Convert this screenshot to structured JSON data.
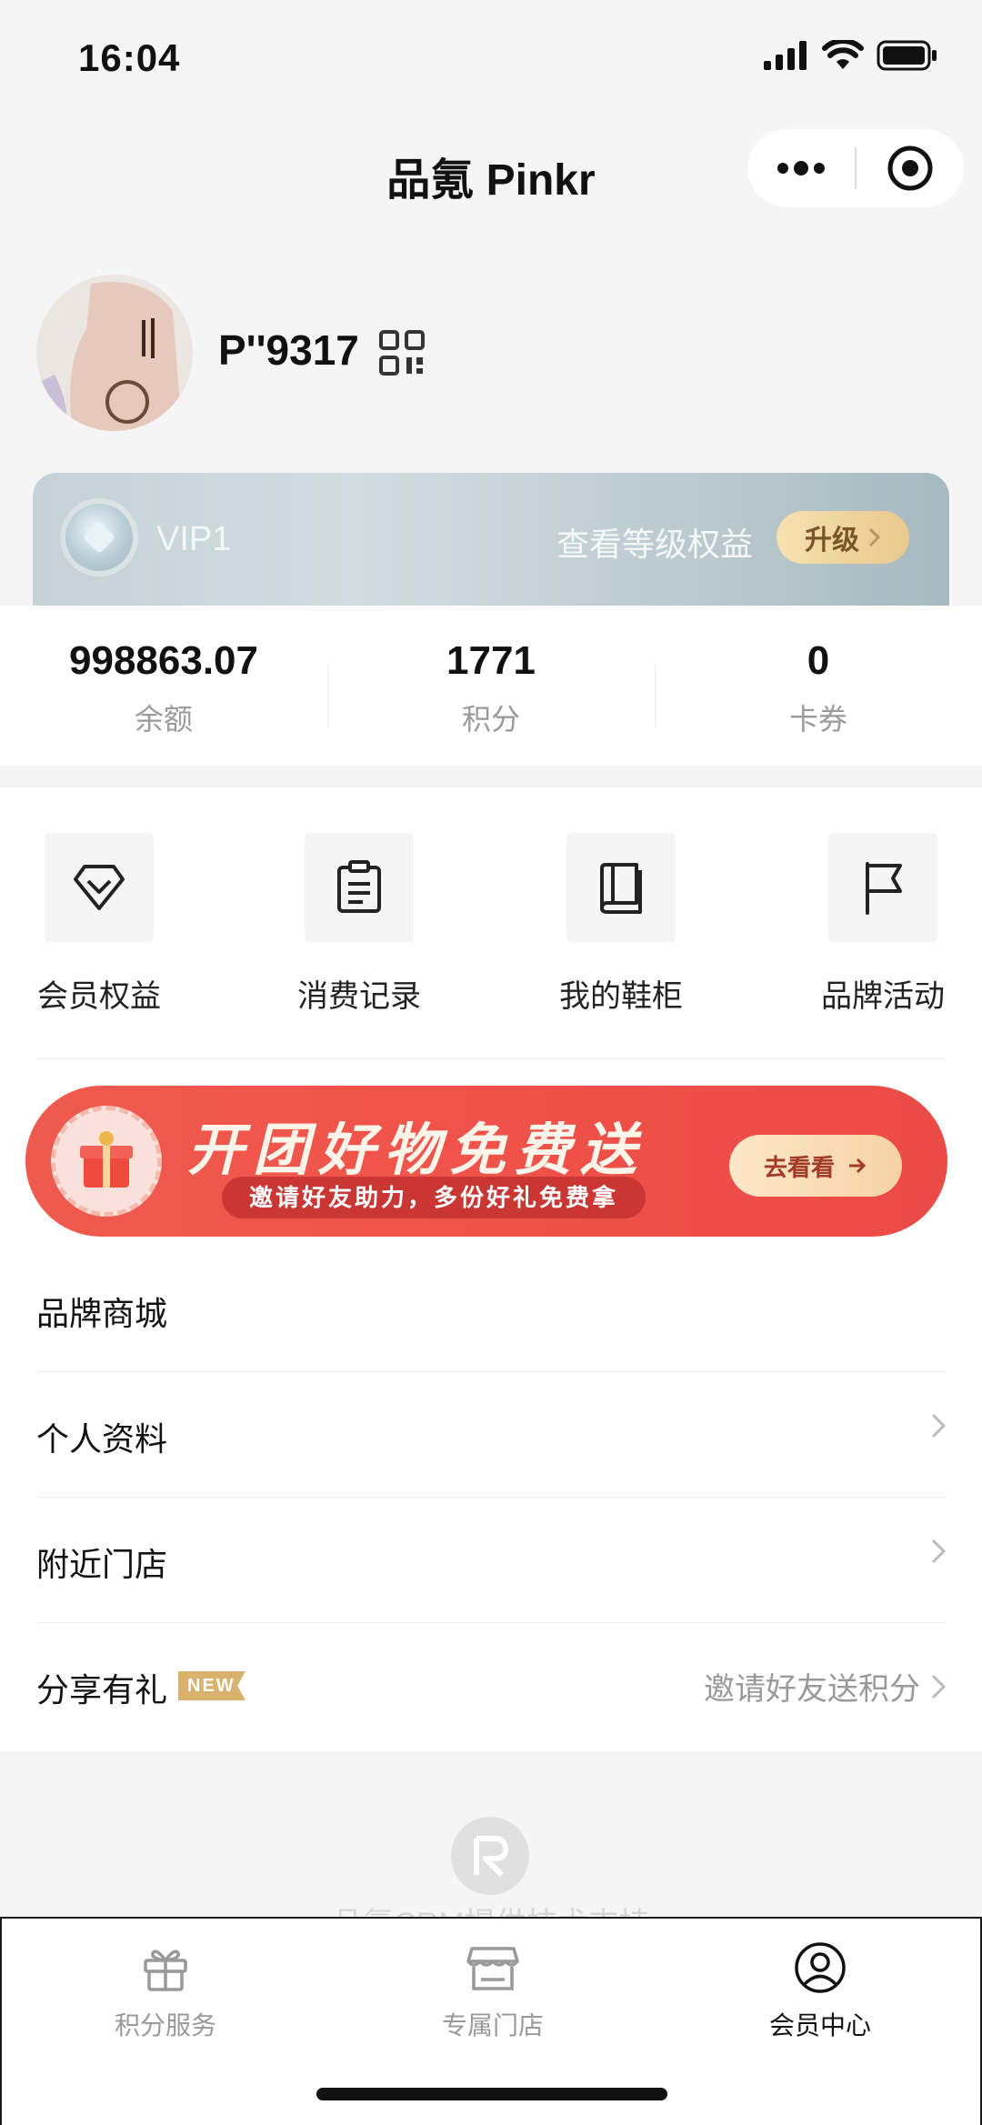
{
  "status": {
    "time": "16:04"
  },
  "nav": {
    "title": "品氪 Pinkr"
  },
  "profile": {
    "username": "P''9317"
  },
  "vip": {
    "level": "VIP1",
    "link": "查看等级权益",
    "upgrade": "升级"
  },
  "stats": [
    {
      "value": "998863.07",
      "label": "余额"
    },
    {
      "value": "1771",
      "label": "积分"
    },
    {
      "value": "0",
      "label": "卡券"
    }
  ],
  "grid": [
    {
      "label": "会员权益",
      "icon": "diamond-icon"
    },
    {
      "label": "消费记录",
      "icon": "clipboard-icon"
    },
    {
      "label": "我的鞋柜",
      "icon": "book-icon"
    },
    {
      "label": "品牌活动",
      "icon": "flag-icon"
    }
  ],
  "banner": {
    "title": "开团好物免费送",
    "subtitle": "邀请好友助力，多份好礼免费拿",
    "button": "去看看"
  },
  "list": [
    {
      "label": "品牌商城"
    },
    {
      "label": "个人资料"
    },
    {
      "label": "附近门店"
    },
    {
      "label": "分享有礼",
      "badge": "NEW",
      "right": "邀请好友送积分"
    }
  ],
  "footer": {
    "powered": "品氪CRM提供技术支持"
  },
  "tabs": [
    {
      "label": "积分服务",
      "icon": "gift-icon"
    },
    {
      "label": "专属门店",
      "icon": "store-icon"
    },
    {
      "label": "会员中心",
      "icon": "user-icon",
      "active": true
    }
  ],
  "colors": {
    "accent": "#ef5a4e",
    "gold": "#e9c98c",
    "muted": "#999999"
  }
}
